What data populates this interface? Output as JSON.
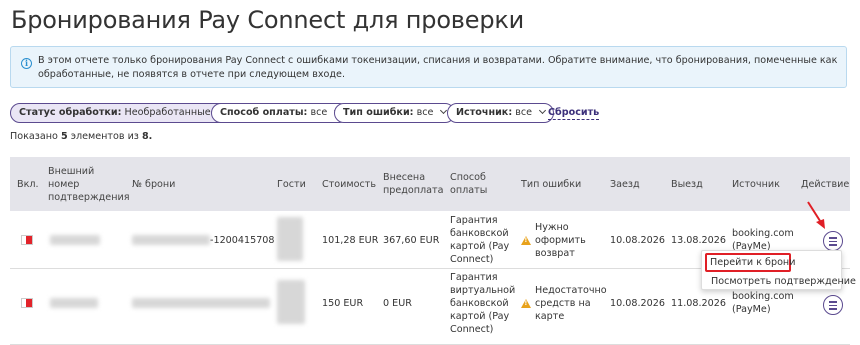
{
  "page": {
    "title": "Бронирования Pay Connect для проверки"
  },
  "info": {
    "text": "В этом отчете только бронирования Pay Connect с ошибками токенизации, списания и возвратами. Обратите внимание, что бронирования, помеченные как обработанные, не появятся в отчете при следующем входе.",
    "icon": "info-icon"
  },
  "filters": {
    "status": {
      "label": "Статус обработки:",
      "value": "Необработанные"
    },
    "payment": {
      "label": "Способ оплаты:",
      "value": "все"
    },
    "error": {
      "label": "Тип ошибки:",
      "value": "все"
    },
    "source": {
      "label": "Источник:",
      "value": "все"
    },
    "reset": "Сбросить"
  },
  "summary": {
    "prefix": "Показано",
    "shown": "5",
    "middle": "элементов из",
    "total": "8."
  },
  "table": {
    "headers": {
      "incl": "Вкл.",
      "external": "Внешний номер подтверждения",
      "booking": "№ брони",
      "guests": "Гости",
      "cost": "Стоимость",
      "prepaid": "Внесена предоплата",
      "method": "Способ оплаты",
      "error": "Тип ошибки",
      "checkin": "Заезд",
      "checkout": "Выезд",
      "source": "Источник",
      "action": "Действие"
    },
    "rows": [
      {
        "booking_suffix": "-1200415708",
        "cost": "101,28 EUR",
        "prepaid": "367,60 EUR",
        "method": "Гарантия банковской картой (Pay Connect)",
        "error": "Нужно оформить возврат",
        "checkin": "10.08.2026",
        "checkout": "13.08.2026",
        "source": "booking.com (PayMe)"
      },
      {
        "booking_suffix": "",
        "cost": "150 EUR",
        "prepaid": "0 EUR",
        "method": "Гарантия виртуальной банковской картой (Pay Connect)",
        "error": "Недостаточно средств на карте",
        "checkin": "10.08.2026",
        "checkout": "11.08.2026",
        "source": "booking.com (PayMe)"
      }
    ]
  },
  "menu": {
    "goto": "Перейти к брони",
    "view": "Посмотреть подтверждение"
  },
  "colors": {
    "accent": "#5b4a8f",
    "highlight": "#e01f26",
    "warning": "#e8a21b",
    "info": "#2a8fcf"
  }
}
